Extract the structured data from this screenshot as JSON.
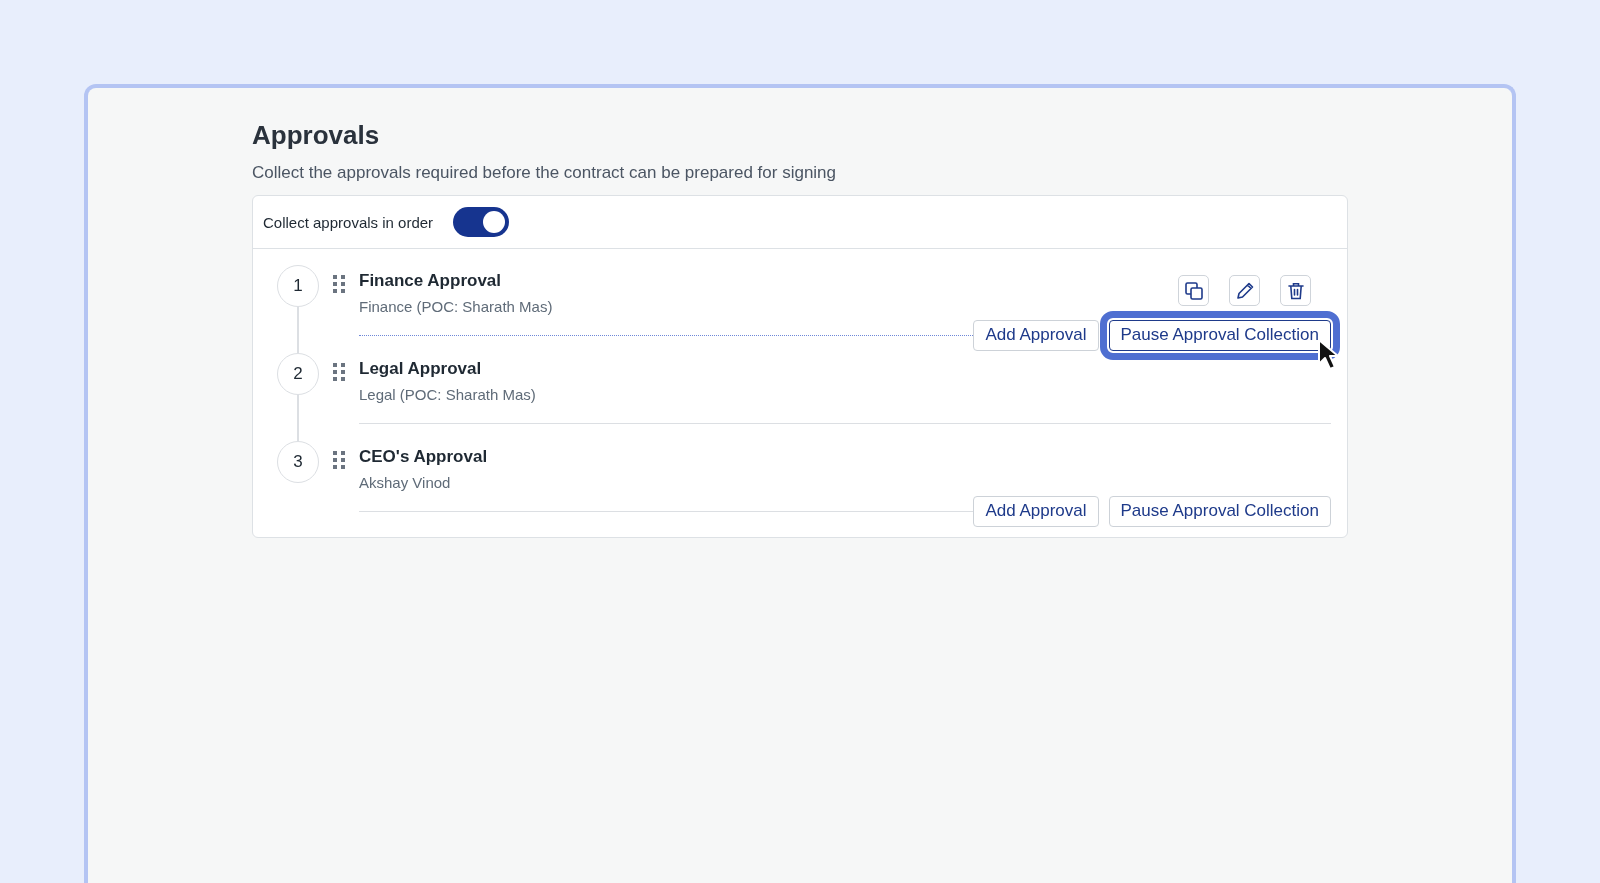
{
  "header": {
    "title": "Approvals",
    "description": "Collect the approvals required before the contract can be prepared for signing"
  },
  "order_toggle": {
    "label": "Collect approvals in order",
    "on": true
  },
  "approvals": [
    {
      "number": "1",
      "title": "Finance Approval",
      "subtitle": "Finance (POC: Sharath Mas)",
      "hovered": true,
      "buttons": [
        {
          "label": "Add Approval",
          "focused": false
        },
        {
          "label": "Pause Approval Collection",
          "focused": true
        }
      ]
    },
    {
      "number": "2",
      "title": "Legal Approval",
      "subtitle": "Legal (POC: Sharath Mas)",
      "hovered": false
    },
    {
      "number": "3",
      "title": "CEO's Approval",
      "subtitle": "Akshay Vinod",
      "hovered": false,
      "buttons": [
        {
          "label": "Add Approval",
          "focused": false
        },
        {
          "label": "Pause Approval Collection",
          "focused": false
        }
      ]
    }
  ]
}
